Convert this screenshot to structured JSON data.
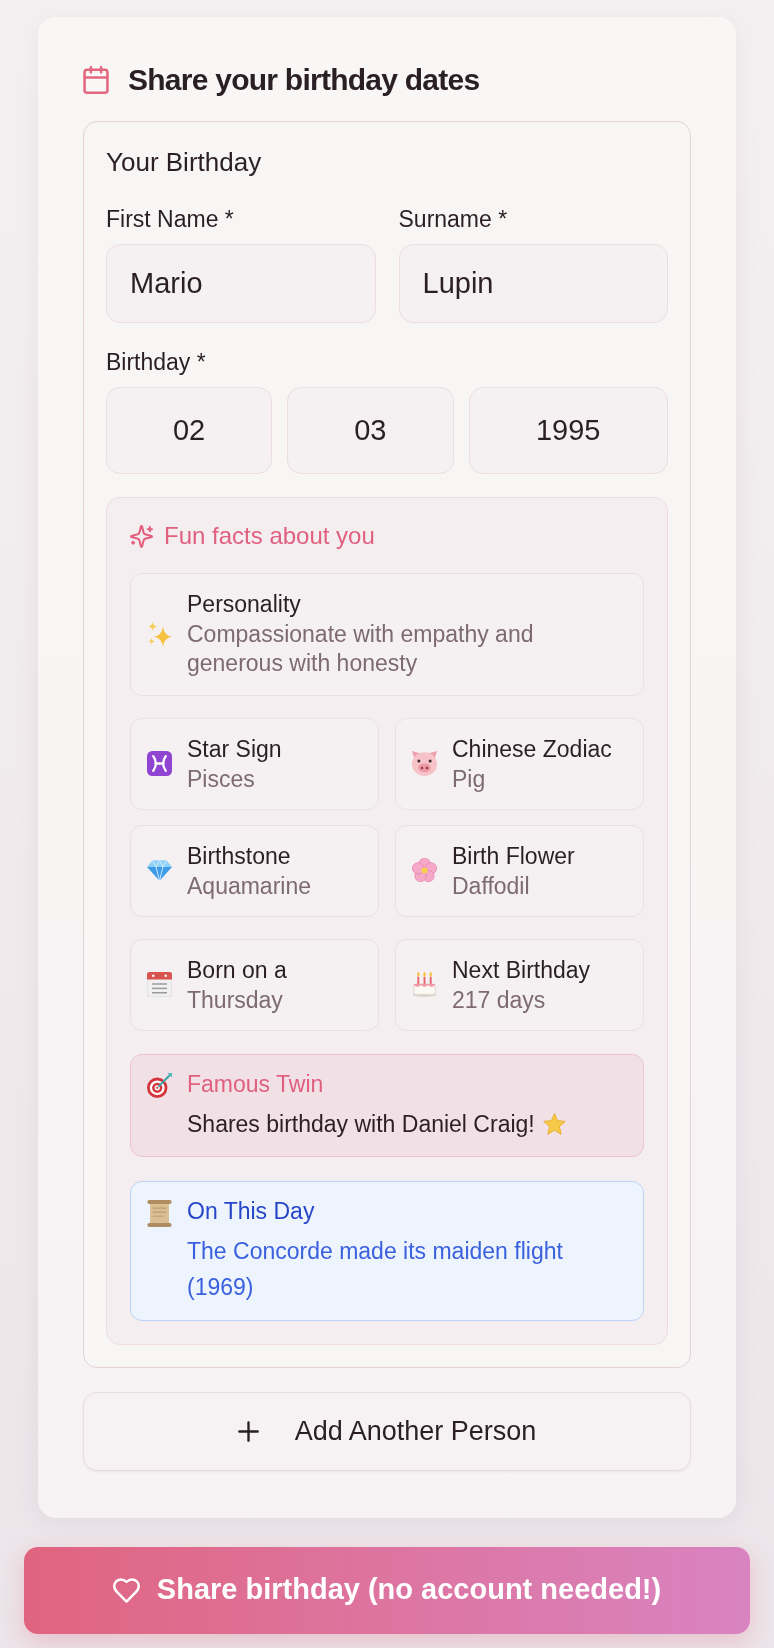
{
  "header": {
    "title": "Share your birthday dates"
  },
  "person": {
    "heading": "Your Birthday",
    "name_fields": [
      {
        "label": "First Name *",
        "value": "Mario"
      },
      {
        "label": "Surname *",
        "value": "Lupin"
      }
    ],
    "birthday": {
      "label": "Birthday *",
      "fields": [
        {
          "value": "02"
        },
        {
          "value": "03"
        },
        {
          "value": "1995"
        }
      ]
    },
    "fun_facts": {
      "title": "Fun facts about you",
      "personality": {
        "label": "Personality",
        "value": "Compassionate with empathy and generous with honesty"
      },
      "fact_groups": [
        {
          "facts": [
            {
              "label": "Star Sign",
              "value": "Pisces"
            },
            {
              "label": "Chinese Zodiac",
              "value": "Pig"
            },
            {
              "label": "Birthstone",
              "value": "Aquamarine"
            },
            {
              "label": "Birth Flower",
              "value": "Daffodil"
            }
          ]
        },
        {
          "facts": [
            {
              "label": "Born on a",
              "value": "Thursday"
            },
            {
              "label": "Next Birthday",
              "value": "217 days"
            }
          ]
        }
      ],
      "highlights": [
        {
          "kind": "twin",
          "label": "Famous Twin",
          "text": "Shares birthday with Daniel Craig!"
        },
        {
          "kind": "history",
          "label": "On This Day",
          "text": "The Concorde made its maiden flight (1969)"
        }
      ]
    }
  },
  "add_button": {
    "label": "Add Another Person"
  },
  "submit_button": {
    "label": "Share birthday (no account needed!)"
  }
}
